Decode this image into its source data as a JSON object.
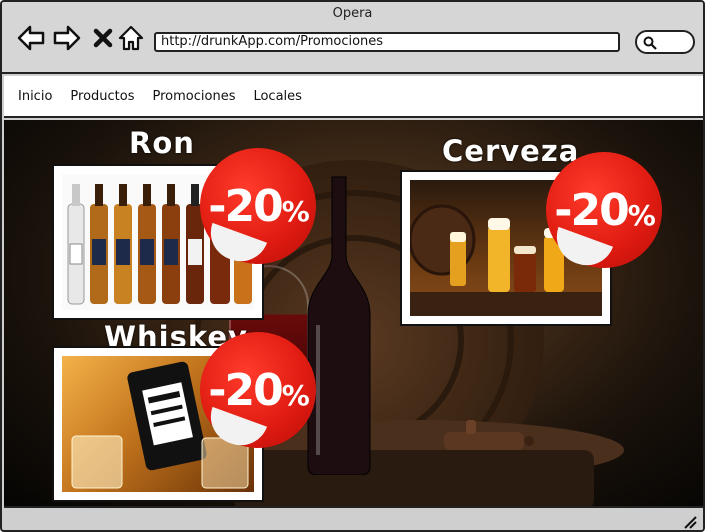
{
  "browser": {
    "window_title": "Opera",
    "url": "http://drunkApp.com/Promociones",
    "nav_icons": [
      "back-arrow-icon",
      "forward-arrow-icon",
      "close-x-icon",
      "home-icon"
    ],
    "search_icon": "search-icon"
  },
  "menu": {
    "items": [
      {
        "label": "Inicio"
      },
      {
        "label": "Productos"
      },
      {
        "label": "Promociones"
      },
      {
        "label": "Locales"
      }
    ]
  },
  "promotions": [
    {
      "title": "Ron",
      "discount": "-20",
      "discount_symbol": "%"
    },
    {
      "title": "Cerveza",
      "discount": "-20",
      "discount_symbol": "%"
    },
    {
      "title": "Whiskey",
      "discount": "-20",
      "discount_symbol": "%"
    }
  ],
  "colors": {
    "badge_red": "#e11c12",
    "chrome_gray": "#d6d6d6",
    "background_brown": "#3d2816"
  }
}
